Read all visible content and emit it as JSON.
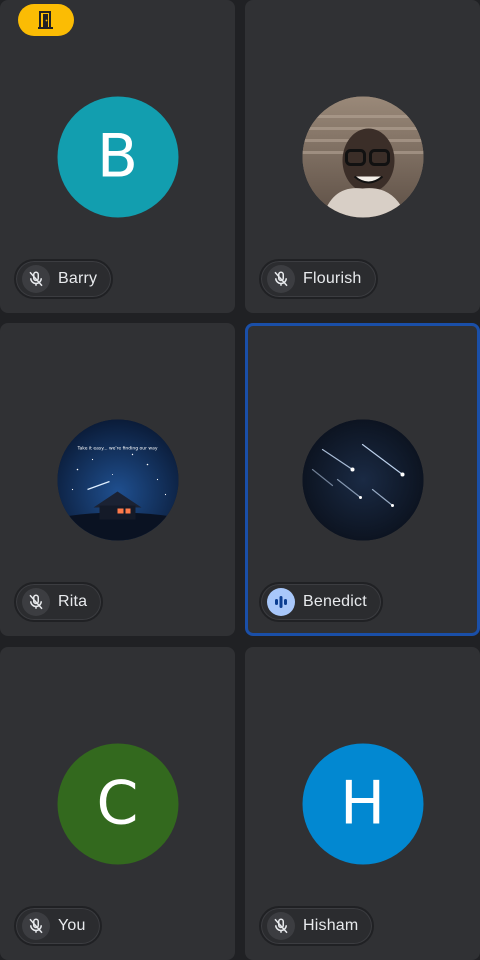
{
  "participants": [
    {
      "name": "Barry",
      "avatar_letter": "B",
      "avatar_color": "#129eaf",
      "mic": "muted"
    },
    {
      "name": "Flourish",
      "avatar_type": "photo",
      "mic": "muted"
    },
    {
      "name": "Rita",
      "avatar_type": "photo",
      "avatar_caption": "Take it easy... we're finding our way",
      "mic": "muted"
    },
    {
      "name": "Benedict",
      "avatar_type": "photo",
      "mic": "speaking",
      "active": true
    },
    {
      "name": "You",
      "avatar_letter": "C",
      "avatar_color": "#33691e",
      "mic": "muted"
    },
    {
      "name": "Hisham",
      "avatar_letter": "H",
      "avatar_color": "#0288d1",
      "mic": "muted"
    }
  ],
  "badge": {
    "icon": "door-exit-icon",
    "color": "#fbbc04"
  },
  "colors": {
    "background": "#202124",
    "tile": "#303134",
    "active_border": "#1a4fa8",
    "speaking": "#a8c7fa"
  }
}
